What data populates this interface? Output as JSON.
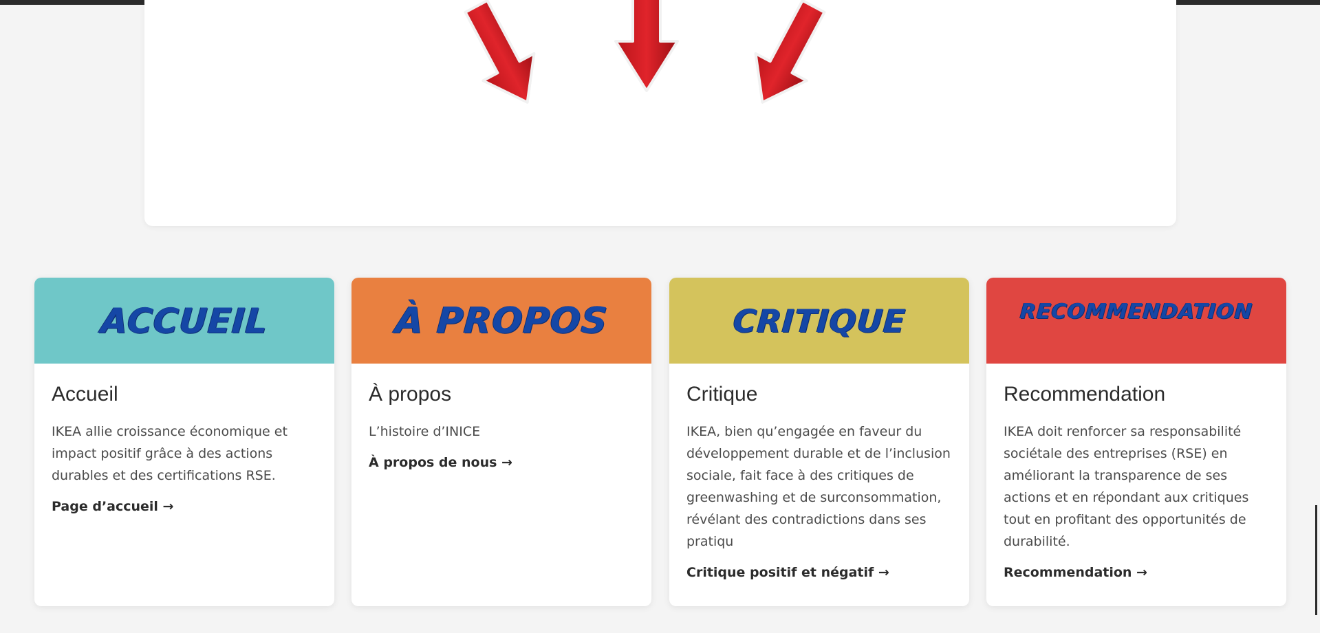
{
  "colors": {
    "background": "#f4f4f4",
    "accent_text": "#1547a6",
    "arrow_red": "#d71920"
  },
  "hero": {
    "arrow_icons": [
      "arrow-down-left-icon",
      "arrow-down-icon",
      "arrow-down-right-icon"
    ]
  },
  "cards": [
    {
      "banner_label": "ACCUEIL",
      "banner_color": "#6fc7c8",
      "title": "Accueil",
      "description": "IKEA allie croissance économique et impact positif grâce à des actions durables et des certifications RSE.",
      "link": "Page d’accueil →"
    },
    {
      "banner_label": "À PROPOS",
      "banner_color": "#e98040",
      "title": "À propos",
      "description": "L’histoire d’INICE",
      "link": "À propos de nous →"
    },
    {
      "banner_label": "CRITIQUE",
      "banner_color": "#d4c35c",
      "title": "Critique",
      "description": "IKEA, bien qu’engagée en faveur du développement durable et de l’inclusion sociale, fait face à des critiques de greenwashing et de surconsommation, révélant des contradictions dans ses pratiqu",
      "link": "Critique positif et négatif →"
    },
    {
      "banner_label": "RECOMMENDATION",
      "banner_color": "#e04641",
      "title": "Recommendation",
      "description": "IKEA doit renforcer sa responsabilité sociétale des entreprises (RSE) en améliorant la transparence de ses actions et en répondant aux critiques tout en profitant des opportunités de durabilité.",
      "link": "Recommendation →"
    }
  ]
}
